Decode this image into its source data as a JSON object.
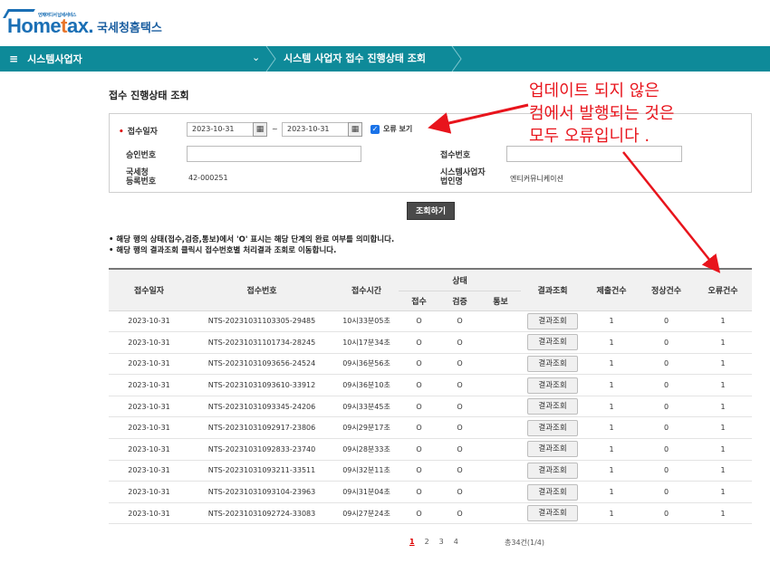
{
  "logo": {
    "main_prefix": "Home",
    "main_t": "t",
    "main_suffix": "ax.",
    "small": "언제어디서 납세서비스",
    "sub": "국세청홈택스"
  },
  "nav": {
    "menu_label": "시스템사업자",
    "chevron": "⌄",
    "breadcrumb": "시스템 사업자 접수 진행상태 조회"
  },
  "page": {
    "title": "접수 진행상태 조회"
  },
  "search": {
    "date_label": "접수일자",
    "date_from": "2023-10-31",
    "date_to": "2023-10-31",
    "tilde": "~",
    "error_view_label": "오류 보기",
    "approval_label": "승인번호",
    "receipt_label": "접수번호",
    "nts_reg_label_1": "국세청",
    "nts_reg_label_2": "등록번호",
    "nts_reg_value": "42-000251",
    "sys_corp_label_1": "시스템사업자",
    "sys_corp_label_2": "법인명",
    "sys_corp_value": "엔티커뮤니케이션",
    "submit_label": "조회하기"
  },
  "notes": [
    "해당 행의 상태(접수,검증,통보)에서 'O' 표시는 해당 단계의 완료 여부를 의미합니다.",
    "해당 행의 결과조회 클릭시 접수번호별 처리결과 조회로 이동합니다."
  ],
  "annotation": {
    "line1": "업데이트 되지 않은",
    "line2": "컴에서 발행되는 것은",
    "line3": "모두 오류입니다 ."
  },
  "table": {
    "headers": {
      "date": "접수일자",
      "receipt_no": "접수번호",
      "time": "접수시간",
      "status": "상태",
      "status_receive": "접수",
      "status_verify": "검증",
      "status_notify": "통보",
      "result": "결과조회",
      "submit_count": "제출건수",
      "normal_count": "정상건수",
      "error_count": "오류건수"
    },
    "result_btn": "결과조회",
    "rows": [
      {
        "date": "2023-10-31",
        "no": "NTS-20231031103305-29485",
        "time": "10시33분05초",
        "r": "O",
        "v": "O",
        "n": "",
        "sub": "1",
        "ok": "0",
        "err": "1"
      },
      {
        "date": "2023-10-31",
        "no": "NTS-20231031101734-28245",
        "time": "10시17분34초",
        "r": "O",
        "v": "O",
        "n": "",
        "sub": "1",
        "ok": "0",
        "err": "1"
      },
      {
        "date": "2023-10-31",
        "no": "NTS-20231031093656-24524",
        "time": "09시36분56초",
        "r": "O",
        "v": "O",
        "n": "",
        "sub": "1",
        "ok": "0",
        "err": "1"
      },
      {
        "date": "2023-10-31",
        "no": "NTS-20231031093610-33912",
        "time": "09시36분10초",
        "r": "O",
        "v": "O",
        "n": "",
        "sub": "1",
        "ok": "0",
        "err": "1"
      },
      {
        "date": "2023-10-31",
        "no": "NTS-20231031093345-24206",
        "time": "09시33분45초",
        "r": "O",
        "v": "O",
        "n": "",
        "sub": "1",
        "ok": "0",
        "err": "1"
      },
      {
        "date": "2023-10-31",
        "no": "NTS-20231031092917-23806",
        "time": "09시29분17초",
        "r": "O",
        "v": "O",
        "n": "",
        "sub": "1",
        "ok": "0",
        "err": "1"
      },
      {
        "date": "2023-10-31",
        "no": "NTS-20231031092833-23740",
        "time": "09시28분33초",
        "r": "O",
        "v": "O",
        "n": "",
        "sub": "1",
        "ok": "0",
        "err": "1"
      },
      {
        "date": "2023-10-31",
        "no": "NTS-20231031093211-33511",
        "time": "09시32분11초",
        "r": "O",
        "v": "O",
        "n": "",
        "sub": "1",
        "ok": "0",
        "err": "1"
      },
      {
        "date": "2023-10-31",
        "no": "NTS-20231031093104-23963",
        "time": "09시31분04초",
        "r": "O",
        "v": "O",
        "n": "",
        "sub": "1",
        "ok": "0",
        "err": "1"
      },
      {
        "date": "2023-10-31",
        "no": "NTS-20231031092724-33083",
        "time": "09시27분24초",
        "r": "O",
        "v": "O",
        "n": "",
        "sub": "1",
        "ok": "0",
        "err": "1"
      }
    ]
  },
  "pagination": {
    "pages": [
      "1",
      "2",
      "3",
      "4"
    ],
    "total": "총34건(1/4)"
  },
  "colors": {
    "nav": "#0e8a99",
    "annotation": "#e8141c",
    "brand": "#1a6fb5"
  }
}
